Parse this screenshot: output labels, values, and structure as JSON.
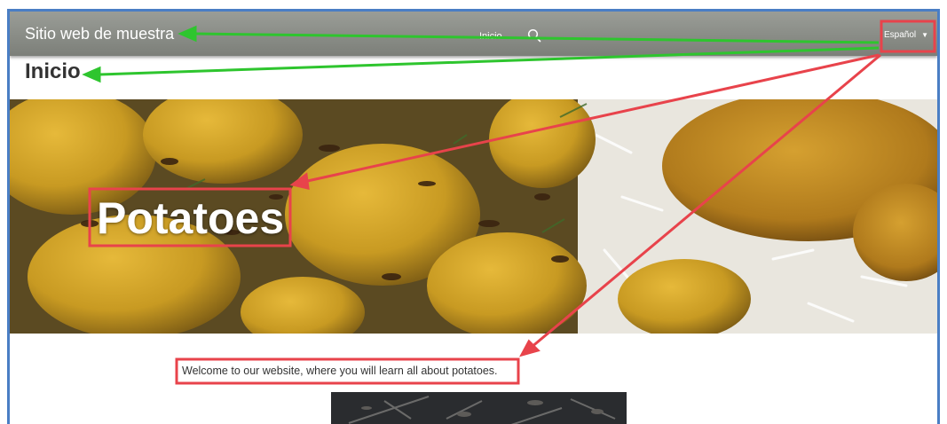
{
  "navbar": {
    "brand": "Sitio web de muestra",
    "links": [
      {
        "label": "Inicio"
      }
    ],
    "search_icon": "search-icon",
    "language": {
      "selected": "Español",
      "caret_icon": "caret-down-icon"
    }
  },
  "page": {
    "title": "Inicio",
    "hero": {
      "title": "Potatoes"
    },
    "welcome_text": "Welcome to our website, where you will learn all about potatoes."
  },
  "annotations": {
    "arrow_colors": {
      "green": "#2ec52e",
      "red": "#e8434b"
    }
  },
  "colors": {
    "frame_border": "#4a7ec4",
    "navbar": "#8a8d87",
    "text": "#333333"
  }
}
